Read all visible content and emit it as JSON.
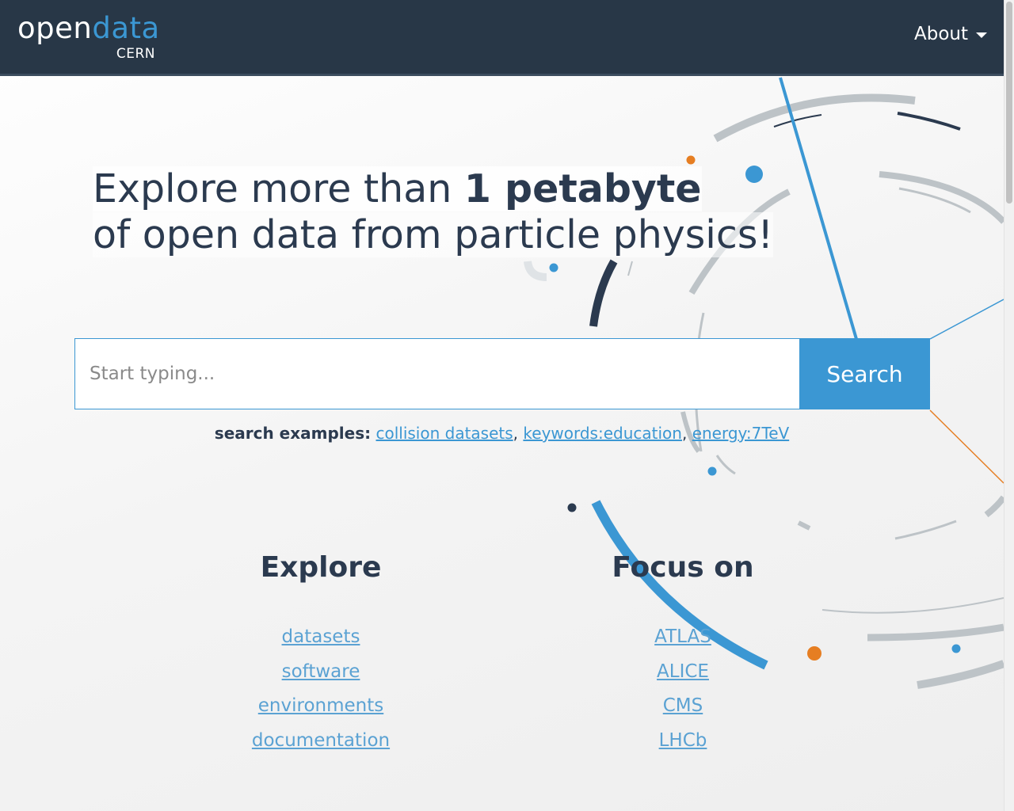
{
  "header": {
    "logo_open": "open",
    "logo_data": "data",
    "logo_sub": "CERN",
    "about_label": "About"
  },
  "hero": {
    "line1_prefix": "Explore more than ",
    "line1_strong": "1 petabyte",
    "line2": "of open data from particle physics!"
  },
  "search": {
    "placeholder": "Start typing...",
    "button_label": "Search",
    "examples_label": "search examples:",
    "examples": [
      "collision datasets",
      "keywords:education",
      "energy:7TeV"
    ]
  },
  "explore": {
    "title": "Explore",
    "links": [
      "datasets",
      "software",
      "environments",
      "documentation"
    ]
  },
  "focus": {
    "title": "Focus on",
    "links": [
      "ATLAS",
      "ALICE",
      "CMS",
      "LHCb"
    ]
  },
  "colors": {
    "navbar": "#283747",
    "accent_blue": "#3b97d3",
    "accent_orange": "#e67e22",
    "text_dark": "#2b3a4f",
    "arc_gray": "#bdc3c7"
  }
}
